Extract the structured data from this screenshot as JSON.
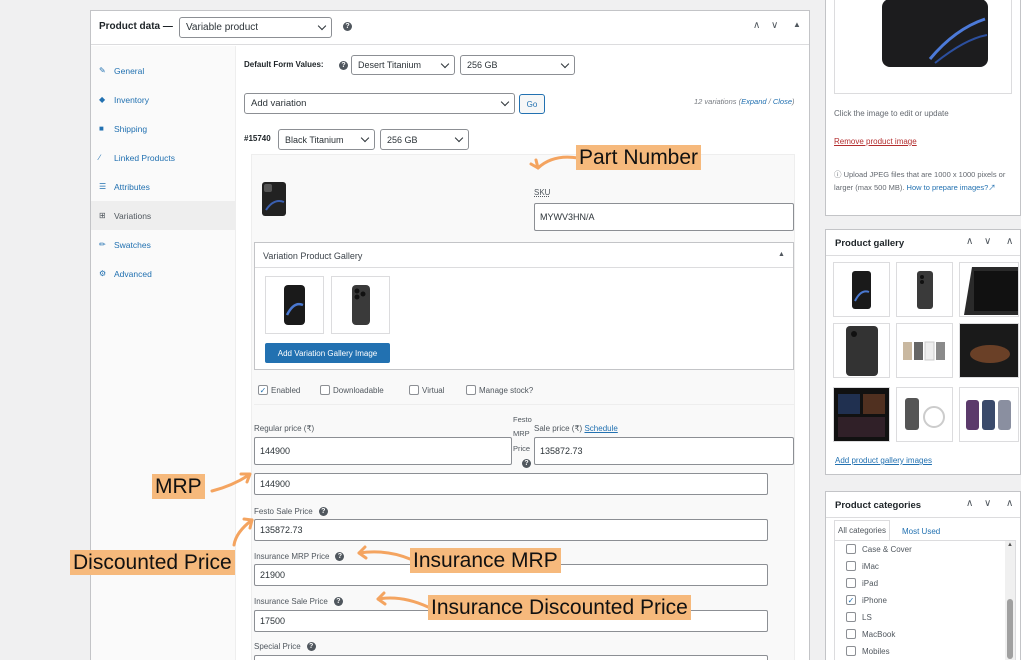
{
  "product_data": {
    "title": "Product data —",
    "type_select": "Variable product",
    "tabs": [
      {
        "label": "General",
        "icon": "wrench-icon"
      },
      {
        "label": "Inventory",
        "icon": "tag-icon"
      },
      {
        "label": "Shipping",
        "icon": "truck-icon"
      },
      {
        "label": "Linked Products",
        "icon": "link-icon"
      },
      {
        "label": "Attributes",
        "icon": "list-icon"
      },
      {
        "label": "Variations",
        "icon": "grid-icon"
      },
      {
        "label": "Swatches",
        "icon": "brush-icon"
      },
      {
        "label": "Advanced",
        "icon": "gear-icon"
      }
    ],
    "default_form_label": "Default Form Values:",
    "default_color": "Desert Titanium",
    "default_storage": "256 GB",
    "add_variation": "Add variation",
    "go_label": "Go",
    "variations_count": "12 variations (",
    "expand": "Expand",
    "sep": " / ",
    "close": "Close",
    "close_paren": ")"
  },
  "variation": {
    "id": "#15740",
    "color": "Black Titanium",
    "storage": "256 GB",
    "sku_label": "SKU",
    "sku_value": "MYWV3HN/A",
    "gallery_title": "Variation Product Gallery",
    "add_gallery_btn": "Add Variation Gallery Image",
    "checkboxes": [
      {
        "label": "Enabled",
        "checked": true
      },
      {
        "label": "Downloadable",
        "checked": false
      },
      {
        "label": "Virtual",
        "checked": false
      },
      {
        "label": "Manage stock?",
        "checked": false
      }
    ],
    "regular_price_label": "Regular price (₹)",
    "regular_price": "144900",
    "festo_mrp_label_1": "Festo",
    "festo_mrp_label_2": "MRP",
    "festo_mrp_label_3": "Price",
    "sale_price_label": "Sale price (₹)",
    "schedule": "Schedule",
    "sale_price": "135872.73",
    "mrp_value": "144900",
    "festo_sale_label": "Festo Sale Price",
    "festo_sale_value": "135872.73",
    "insurance_mrp_label": "Insurance MRP Price",
    "insurance_mrp_value": "21900",
    "insurance_sale_label": "Insurance Sale Price",
    "insurance_sale_value": "17500",
    "special_price_label": "Special Price"
  },
  "annotations": {
    "part_number": "Part Number",
    "mrp": "MRP",
    "discounted": "Discounted Price",
    "insurance_mrp": "Insurance MRP",
    "insurance_discounted": "Insurance Discounted Price"
  },
  "product_image": {
    "click_text": "Click the image to edit or update",
    "remove": "Remove product image",
    "upload_note": "Upload JPEG files that are 1000 x 1000 pixels or larger (max 500 MB).",
    "how_to": "How to prepare images?"
  },
  "product_gallery": {
    "title": "Product gallery",
    "add_link": "Add product gallery images"
  },
  "product_categories": {
    "title": "Product categories",
    "tab_all": "All categories",
    "tab_most": "Most Used",
    "items": [
      {
        "label": "Case & Cover",
        "checked": false
      },
      {
        "label": "iMac",
        "checked": false
      },
      {
        "label": "iPad",
        "checked": false
      },
      {
        "label": "iPhone",
        "checked": true
      },
      {
        "label": "LS",
        "checked": false
      },
      {
        "label": "MacBook",
        "checked": false
      },
      {
        "label": "Mobiles",
        "checked": false
      }
    ]
  },
  "colors": {
    "accent": "#2271b1",
    "annotation": "#f6b97c",
    "arrow": "#f4a460"
  }
}
